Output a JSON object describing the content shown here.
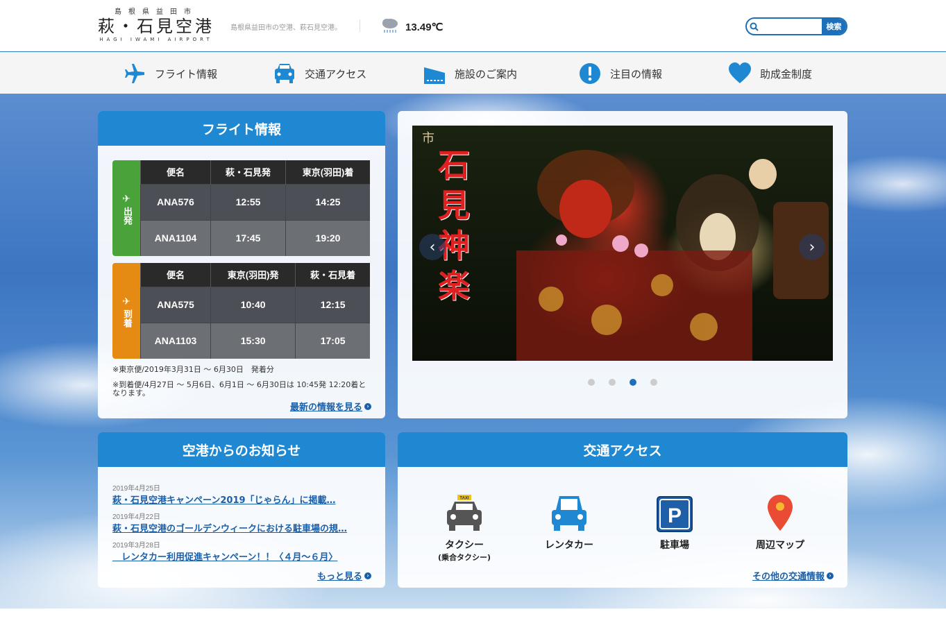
{
  "header": {
    "logo_pref": "島根県益田市",
    "logo_name": "萩・石見空港",
    "logo_en": "HAGI IWAMI AIRPORT",
    "tagline": "島根県益田市の空港、萩石見空港。",
    "weather_icon": "rain-cloud-icon",
    "temperature": "13.49℃",
    "search_placeholder": "",
    "search_button": "検索"
  },
  "nav": {
    "items": [
      {
        "label": "フライト情報",
        "icon": "airplane-icon"
      },
      {
        "label": "交通アクセス",
        "icon": "car-icon"
      },
      {
        "label": "施設のご案内",
        "icon": "building-icon"
      },
      {
        "label": "注目の情報",
        "icon": "exclamation-icon"
      },
      {
        "label": "助成金制度",
        "icon": "heart-icon"
      }
    ]
  },
  "flight": {
    "title": "フライト情報",
    "departure": {
      "side_label": "出発",
      "headers": [
        "便名",
        "萩・石見発",
        "東京(羽田)着"
      ],
      "rows": [
        [
          "ANA576",
          "12:55",
          "14:25"
        ],
        [
          "ANA1104",
          "17:45",
          "19:20"
        ]
      ]
    },
    "arrival": {
      "side_label": "到着",
      "headers": [
        "便名",
        "東京(羽田)発",
        "萩・石見着"
      ],
      "rows": [
        [
          "ANA575",
          "10:40",
          "12:15"
        ],
        [
          "ANA1103",
          "15:30",
          "17:05"
        ]
      ]
    },
    "note1": "※東京便/2019年3月31日 〜 6月30日　発着分",
    "note2": "※到着便/4月27日 〜 5月6日、6月1日 〜 6月30日は 10:45発 12:20着となります。",
    "more_link": "最新の情報を見る"
  },
  "slider": {
    "image_text": "石見神楽",
    "image_corner": "市",
    "prev": "‹",
    "next": "›",
    "slide_count": 4,
    "active_index": 2
  },
  "news": {
    "title": "空港からのお知らせ",
    "items": [
      {
        "date": "2019年4月25日",
        "title": "萩・石見空港キャンペーン2019「じゃらん」に掲載…"
      },
      {
        "date": "2019年4月22日",
        "title": "萩・石見空港のゴールデンウィークにおける駐車場の規…"
      },
      {
        "date": "2019年3月28日",
        "title": "　レンタカー利用促進キャンペーン！！〈４月～６月〉"
      }
    ],
    "more_link": "もっと見る"
  },
  "access": {
    "title": "交通アクセス",
    "items": [
      {
        "label": "タクシー",
        "sub": "(乗合タクシー)",
        "icon": "taxi-icon",
        "taxi_sign": "TAXI"
      },
      {
        "label": "レンタカー",
        "sub": "",
        "icon": "rental-car-icon"
      },
      {
        "label": "駐車場",
        "sub": "",
        "icon": "parking-icon",
        "parking_letter": "P"
      },
      {
        "label": "周辺マップ",
        "sub": "",
        "icon": "map-pin-icon"
      }
    ],
    "more_link": "その他の交通情報"
  },
  "colors": {
    "brand_blue": "#1e88d2",
    "departure_green": "#4aa33a",
    "arrival_orange": "#e58a12",
    "link_blue": "#1a5fa9"
  }
}
